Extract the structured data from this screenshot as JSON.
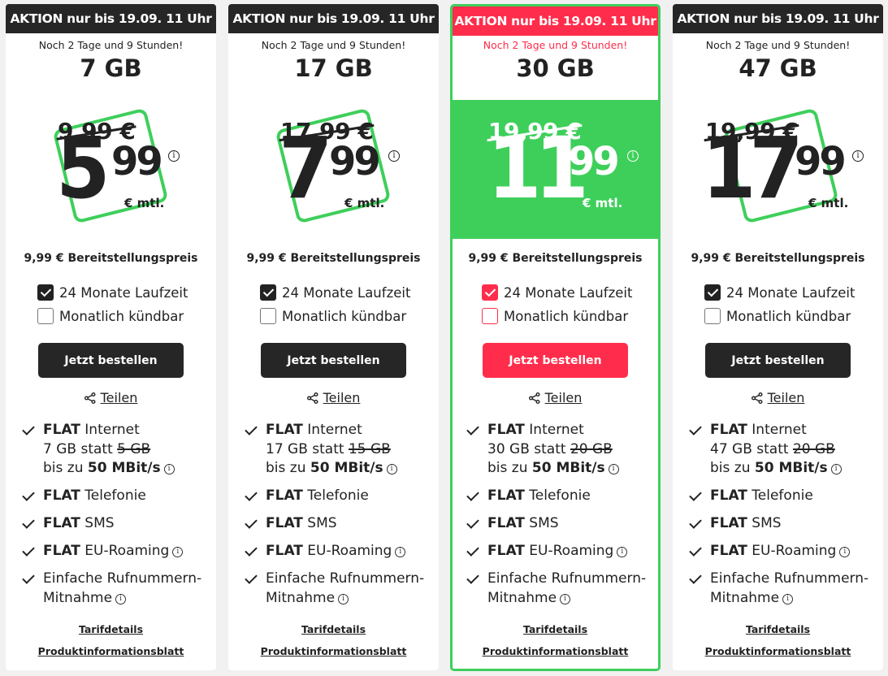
{
  "common": {
    "banner_action": "AKTION",
    "banner_until": "nur bis 19.09. 11 Uhr",
    "countdown": "Noch 2 Tage und 9 Stunden!",
    "setup_fee": "9,99 € Bereitstellungspreis",
    "per_month": "€ mtl.",
    "info_glyph": "i",
    "term_24": "24 Monate Laufzeit",
    "term_monthly": "Monatlich kündbar",
    "order_label": "Jetzt bestellen",
    "share_label": "Teilen",
    "feat_flat": "FLAT",
    "feat_internet": "Internet",
    "feat_statt": "statt",
    "feat_speed_pre": "bis zu",
    "feat_speed": "50 MBit/s",
    "feat_telefonie": "Telefonie",
    "feat_sms": "SMS",
    "feat_roaming": "EU-Roaming",
    "feat_port_1": "Einfache Rufnummern-",
    "feat_port_2": "Mitnahme",
    "link_details": "Tarifdetails",
    "link_pib": "Produktinformationsblatt"
  },
  "plans": [
    {
      "gb": "7 GB",
      "old_price": "9,99 €",
      "price_euros": "5",
      "price_cents": "99",
      "included": "7 GB",
      "previous": "5 GB",
      "term_24_checked": true,
      "term_monthly_checked": false,
      "highlighted": false
    },
    {
      "gb": "17 GB",
      "old_price": "17,99 €",
      "price_euros": "7",
      "price_cents": "99",
      "included": "17 GB",
      "previous": "15 GB",
      "term_24_checked": true,
      "term_monthly_checked": false,
      "highlighted": false
    },
    {
      "gb": "30 GB",
      "old_price": "19,99 €",
      "price_euros": "11",
      "price_cents": "99",
      "included": "30 GB",
      "previous": "20 GB",
      "term_24_checked": true,
      "term_monthly_checked": false,
      "highlighted": true
    },
    {
      "gb": "47 GB",
      "old_price": "19,99 €",
      "price_euros": "17",
      "price_cents": "99",
      "included": "47 GB",
      "previous": "20 GB",
      "term_24_checked": true,
      "term_monthly_checked": false,
      "highlighted": false
    }
  ],
  "colors": {
    "accent_red": "#ff2d4b",
    "accent_green": "#3ecf5b",
    "dark": "#262626"
  },
  "icons": {
    "check": "check-icon",
    "info": "info-icon",
    "share": "share-icon"
  }
}
